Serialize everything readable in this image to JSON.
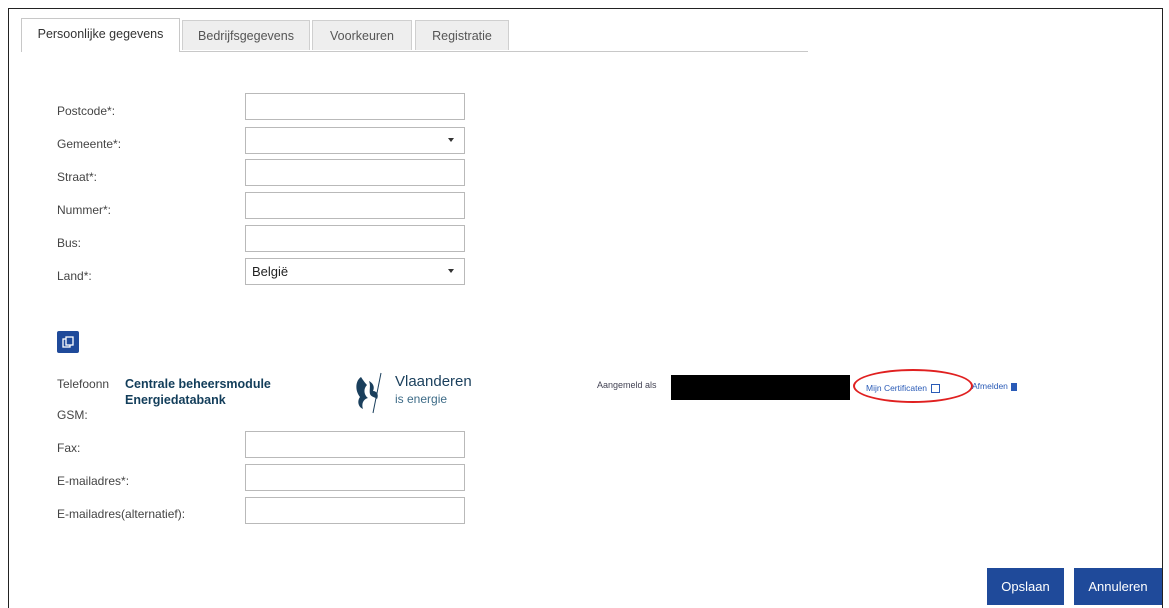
{
  "tabs": [
    "Persoonlijke gegevens",
    "Bedrijfsgegevens",
    "Voorkeuren",
    "Registratie"
  ],
  "fields": {
    "postcode": {
      "label": "Postcode*:",
      "value": ""
    },
    "gemeente": {
      "label": "Gemeente*:",
      "value": ""
    },
    "straat": {
      "label": "Straat*:",
      "value": ""
    },
    "nummer": {
      "label": "Nummer*:",
      "value": ""
    },
    "bus": {
      "label": "Bus:",
      "value": ""
    },
    "land": {
      "label": "Land*:",
      "value": "België"
    },
    "telefoon": {
      "label": "Telefoonn"
    },
    "gsm": {
      "label": "GSM:"
    },
    "fax": {
      "label": "Fax:",
      "value": ""
    },
    "email": {
      "label": "E-mailadres*:",
      "value": ""
    },
    "email_alt": {
      "label": "E-mailadres(alternatief):",
      "value": ""
    }
  },
  "banner": {
    "title_line1": "Centrale beheersmodule",
    "title_line2": "Energiedatabank",
    "brand": "Vlaanderen",
    "brand_sub": "is energie",
    "logged_in_label": "Aangemeld als",
    "certificates_link": "Mijn Certificaten",
    "logout_link": "Afmelden"
  },
  "buttons": {
    "save": "Opslaan",
    "cancel": "Annuleren"
  },
  "colors": {
    "primary": "#1f4a9a",
    "highlight": "#e02020"
  }
}
